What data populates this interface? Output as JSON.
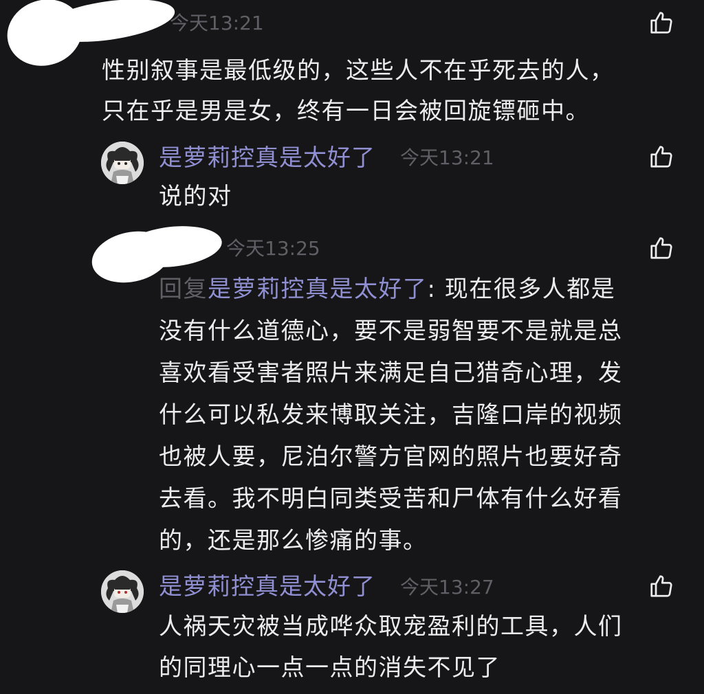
{
  "comments": [
    {
      "time": "今天13:21",
      "lines": [
        "性别叙事是最低级的，这些人不在乎死去的人，",
        "只在乎是男是女，终有一日会被回旋镖砸中。"
      ]
    },
    {
      "name": "是萝莉控真是太好了",
      "time": "今天13:21",
      "lines": [
        "说的对"
      ]
    },
    {
      "time": "今天13:25",
      "reply_prefix": "回复",
      "reply_name": "是萝莉控真是太好了",
      "reply_first_rest": ": 现在很多人都是",
      "lines": [
        "没有什么道德心，要不是弱智要不是就是总",
        "喜欢看受害者照片来满足自己猎奇心理，发",
        "什么可以私发来博取关注，吉隆口岸的视频",
        "也被人要，尼泊尔警方官网的照片也要好奇",
        "去看。我不明白同类受苦和尸体有什么好看",
        "的，还是那么惨痛的事。"
      ]
    },
    {
      "name": "是萝莉控真是太好了",
      "time": "今天13:27",
      "lines": [
        "人祸天灾被当成哗众取宠盈利的工具，人们",
        "的同理心一点一点的消失不见了"
      ]
    }
  ],
  "icons": {
    "like": "thumbs-up-icon",
    "avatar": "anime-avatar"
  },
  "colors": {
    "background": "#161618",
    "text": "#ececee",
    "username": "#8f8fd2",
    "meta": "#5f5f65"
  }
}
